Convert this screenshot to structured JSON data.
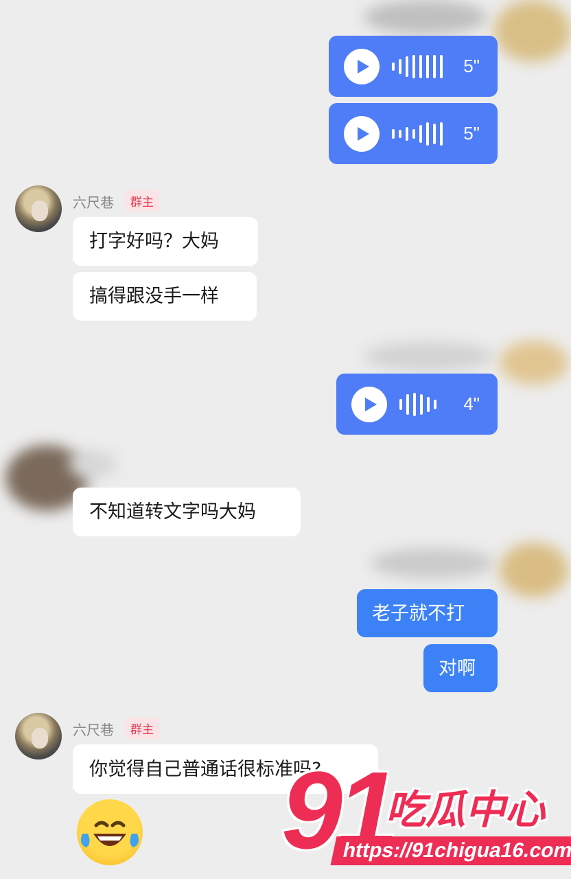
{
  "colors": {
    "outgoing": "#3c82f6",
    "voice": "#4f7cf7",
    "incoming": "#ffffff",
    "background": "#ededed",
    "badge_text": "#e53950",
    "watermark": "#ee2d55"
  },
  "messages": {
    "voice_1": {
      "duration": "5\""
    },
    "voice_2": {
      "duration": "5\""
    },
    "group_1": {
      "sender": "六尺巷",
      "badge": "群主",
      "lines": [
        "打字好吗？大妈",
        "搞得跟没手一样"
      ]
    },
    "voice_3": {
      "duration": "4\""
    },
    "incoming_2": {
      "text": "不知道转文字吗大妈"
    },
    "outgoing_1": {
      "text": "老子就不打"
    },
    "outgoing_2": {
      "text": "对啊"
    },
    "group_2": {
      "sender": "六尺巷",
      "badge": "群主",
      "text": "你觉得自己普通话很标准吗?",
      "emoji": "grinning-tears-emoji"
    }
  },
  "watermark": {
    "number": "91",
    "title": "吃瓜中心",
    "url": "https://91chigua16.com"
  }
}
